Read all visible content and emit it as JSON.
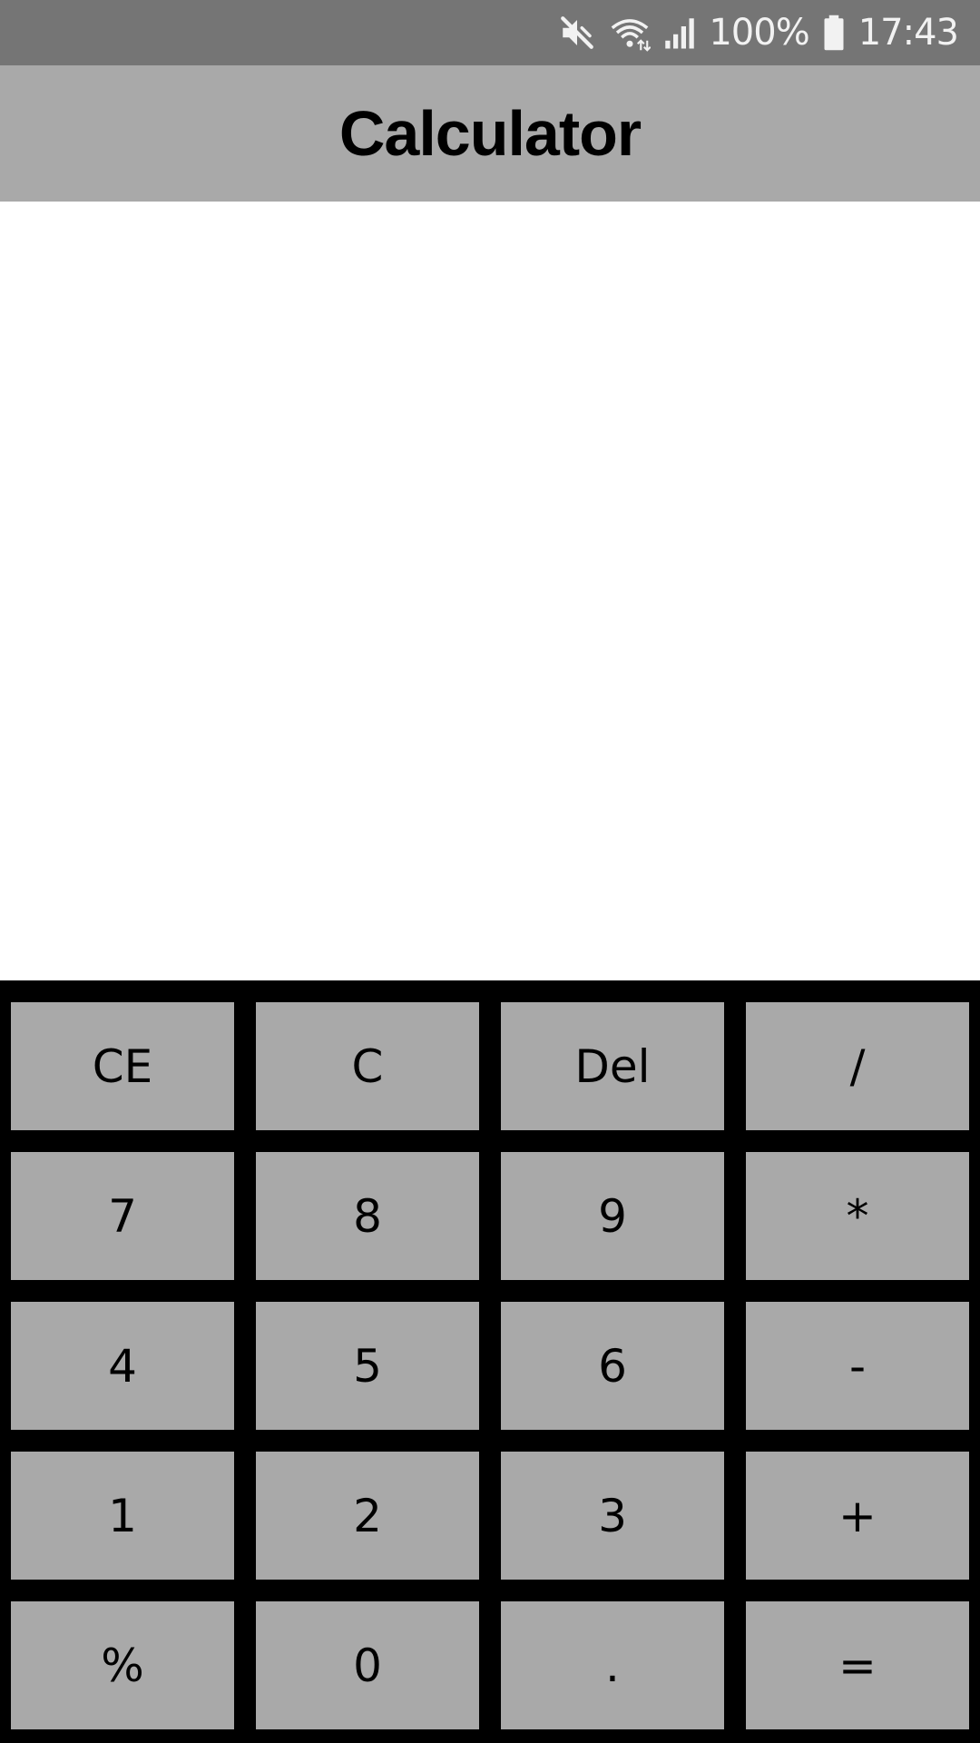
{
  "status_bar": {
    "battery_percent": "100%",
    "time": "17:43",
    "icons": [
      "mute-icon",
      "wifi-icon",
      "signal-icon",
      "battery-icon"
    ]
  },
  "app_bar": {
    "title": "Calculator"
  },
  "display": {
    "value": ""
  },
  "keypad": {
    "keys": [
      {
        "label": "CE"
      },
      {
        "label": "C"
      },
      {
        "label": "Del"
      },
      {
        "label": "/"
      },
      {
        "label": "7"
      },
      {
        "label": "8"
      },
      {
        "label": "9"
      },
      {
        "label": "*"
      },
      {
        "label": "4"
      },
      {
        "label": "5"
      },
      {
        "label": "6"
      },
      {
        "label": "-"
      },
      {
        "label": "1"
      },
      {
        "label": "2"
      },
      {
        "label": "3"
      },
      {
        "label": "+"
      },
      {
        "label": "%"
      },
      {
        "label": "0"
      },
      {
        "label": "."
      },
      {
        "label": "="
      }
    ]
  },
  "colors": {
    "status_bar_bg": "#757575",
    "app_bar_bg": "#a9a9a9",
    "key_bg": "#a9a9a9",
    "keypad_bg": "#000000",
    "display_bg": "#ffffff"
  }
}
